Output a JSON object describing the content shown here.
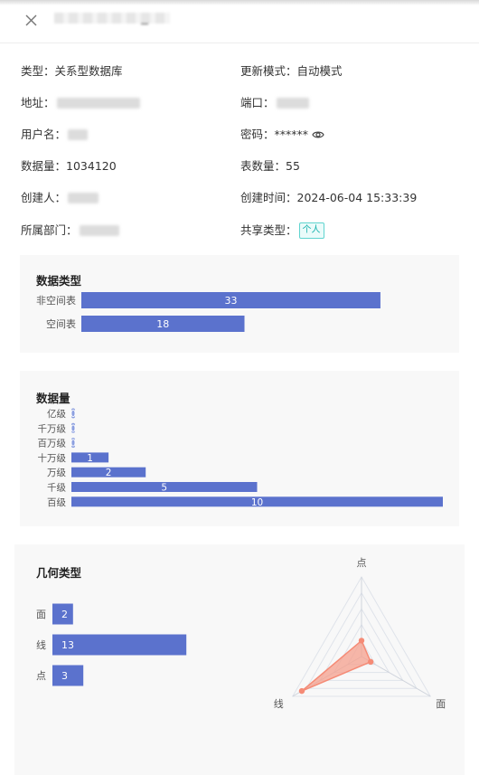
{
  "colors": {
    "bar": "#5b72cd",
    "radar_line": "#f58b76",
    "radar_fill": "#f5a08d",
    "badge": "#16b2ad"
  },
  "header": {
    "close_icon": "close-icon"
  },
  "info": {
    "type_label": "类型：",
    "type_value": "关系型数据库",
    "update_label": "更新模式：",
    "update_value": "自动模式",
    "address_label": "地址：",
    "port_label": "端口：",
    "user_label": "用户名：",
    "password_label": "密码：",
    "password_value": "******",
    "password_icon": "eye-icon",
    "rows_label": "数据量：",
    "rows_value": "1034120",
    "tables_label": "表数量：",
    "tables_value": "55",
    "creator_label": "创建人：",
    "created_label": "创建时间：",
    "created_value": "2024-06-04 15:33:39",
    "dept_label": "所属部门：",
    "share_label": "共享类型：",
    "share_value": "个人"
  },
  "charts": {
    "data_type": {
      "title": "数据类型",
      "chart_data": {
        "type": "bar",
        "orientation": "horizontal",
        "categories": [
          "非空间表",
          "空间表"
        ],
        "values": [
          33,
          18
        ],
        "xlim": [
          0,
          35
        ]
      }
    },
    "data_volume": {
      "title": "数据量",
      "chart_data": {
        "type": "bar",
        "orientation": "horizontal",
        "categories": [
          "亿级",
          "千万级",
          "百万级",
          "十万级",
          "万级",
          "千级",
          "百级"
        ],
        "values": [
          0,
          0,
          0,
          1,
          2,
          5,
          10
        ],
        "xlim": [
          0,
          10
        ]
      }
    },
    "geometry": {
      "title": "几何类型",
      "chart_data": [
        {
          "type": "bar",
          "orientation": "horizontal",
          "categories": [
            "面",
            "线",
            "点"
          ],
          "values": [
            2,
            13,
            3
          ],
          "xlim": [
            0,
            15
          ]
        },
        {
          "type": "radar",
          "indicators": [
            "点",
            "线",
            "面"
          ],
          "values": [
            3,
            13,
            2
          ],
          "max": 15
        }
      ]
    }
  }
}
